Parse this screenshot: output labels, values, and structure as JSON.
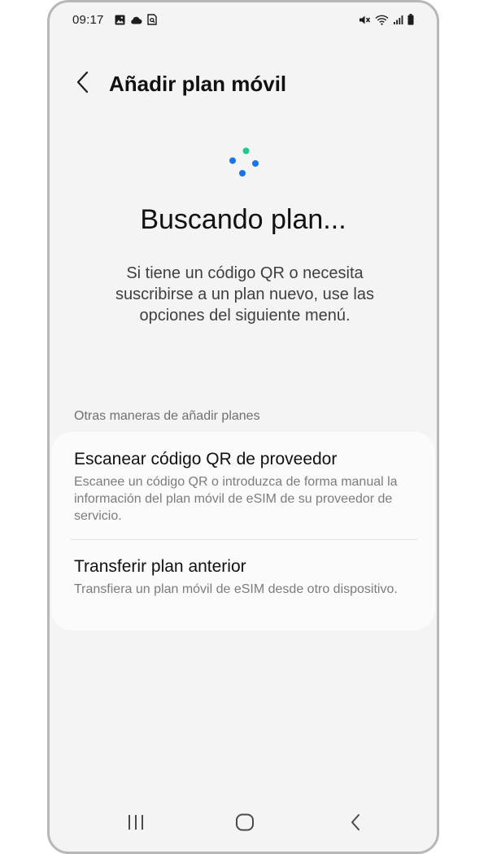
{
  "status_bar": {
    "time": "09:17",
    "left_icons": [
      "gallery-icon",
      "cloud-icon",
      "screenshot-icon"
    ],
    "right_icons": [
      "mute-icon",
      "wifi-icon",
      "signal-icon",
      "battery-icon"
    ]
  },
  "header": {
    "title": "Añadir plan móvil",
    "back_icon": "chevron-left-icon"
  },
  "main": {
    "heading": "Buscando plan...",
    "description": "Si tiene un código QR o necesita suscribirse a un plan nuevo, use las opciones del siguiente menú."
  },
  "options_section": {
    "label": "Otras maneras de añadir planes",
    "items": [
      {
        "title": "Escanear código QR de proveedor",
        "description": "Escanee un código QR o introduzca de forma manual la información del plan móvil de eSIM de su proveedor de servicio."
      },
      {
        "title": "Transferir plan anterior",
        "description": "Transfiera un plan móvil de eSIM desde otro dispositivo."
      }
    ]
  },
  "nav_bar": {
    "buttons": [
      "recents-icon",
      "home-icon",
      "back-icon"
    ]
  },
  "colors": {
    "spinner_green": "#1ec98b",
    "spinner_blue": "#1a73e8",
    "background": "#f4f4f4",
    "card": "#fbfbfb"
  }
}
